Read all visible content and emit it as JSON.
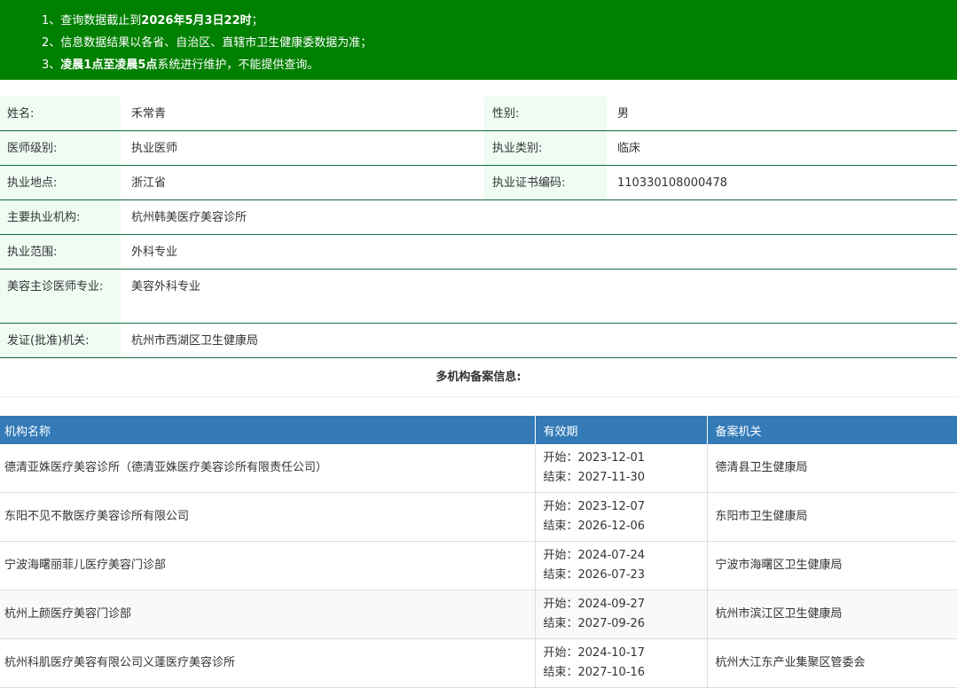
{
  "notice": {
    "line1_prefix": "1、查询数据截止到",
    "line1_bold": "2026年5月3日22时",
    "line1_suffix": "；",
    "line2": "2、信息数据结果以各省、自治区、直辖市卫生健康委数据为准；",
    "line3_prefix": "3、",
    "line3_bold": "凌晨1点至凌晨5点",
    "line3_suffix": "系统进行维护，不能提供查询。"
  },
  "info": {
    "name_label": "姓名:",
    "name_value": "禾常青",
    "gender_label": "性别:",
    "gender_value": "男",
    "level_label": "医师级别:",
    "level_value": "执业医师",
    "category_label": "执业类别:",
    "category_value": "临床",
    "location_label": "执业地点:",
    "location_value": "浙江省",
    "cert_label": "执业证书编码:",
    "cert_value": "110330108000478",
    "institution_label": "主要执业机构:",
    "institution_value": "杭州韩美医疗美容诊所",
    "scope_label": "执业范围:",
    "scope_value": "外科专业",
    "cosmetic_label": "美容主诊医师专业:",
    "cosmetic_value": "美容外科专业",
    "issuer_label": "发证(批准)机关:",
    "issuer_value": "杭州市西湖区卫生健康局"
  },
  "multi_title": "多机构备案信息:",
  "table": {
    "headers": [
      "机构名称",
      "有效期",
      "备案机关"
    ],
    "rows": [
      {
        "name": "德清亚姝医疗美容诊所（德清亚姝医疗美容诊所有限责任公司）",
        "start": "开始：2023-12-01",
        "end": "结束：2027-11-30",
        "authority": "德清县卫生健康局"
      },
      {
        "name": "东阳不见不散医疗美容诊所有限公司",
        "start": "开始：2023-12-07",
        "end": "结束：2026-12-06",
        "authority": "东阳市卫生健康局"
      },
      {
        "name": "宁波海曙丽菲儿医疗美容门诊部",
        "start": "开始：2024-07-24",
        "end": "结束：2026-07-23",
        "authority": "宁波市海曙区卫生健康局"
      },
      {
        "name": "杭州上颜医疗美容门诊部",
        "start": "开始：2024-09-27",
        "end": "结束：2027-09-26",
        "authority": "杭州市滨江区卫生健康局"
      },
      {
        "name": "杭州科肌医疗美容有限公司义蓬医疗美容诊所",
        "start": "开始：2024-10-17",
        "end": "结束：2027-10-16",
        "authority": "杭州大江东产业集聚区管委会"
      }
    ]
  },
  "colors": {
    "notice_bg": "#008000",
    "label_bg": "#eefcf3",
    "header_bg": "#337ab7",
    "row_border": "#1a6b3a"
  }
}
